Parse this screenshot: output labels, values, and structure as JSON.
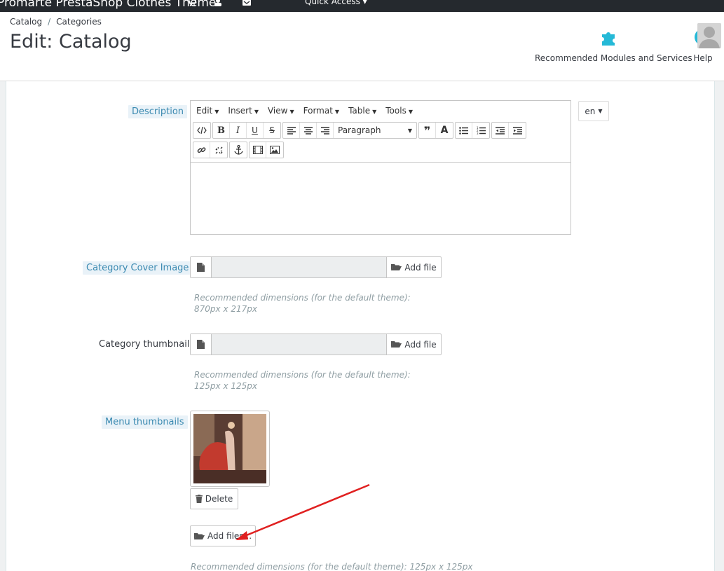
{
  "topbar": {
    "shop_name": "Promarte PrestaShop Clothes Theme",
    "quick_access": "Quick Access"
  },
  "breadcrumb": {
    "items": [
      "Catalog",
      "Categories"
    ]
  },
  "page_title": "Edit: Catalog",
  "toolbar": {
    "modules_label": "Recommended Modules and Services",
    "help_label": "Help"
  },
  "form": {
    "description": {
      "label": "Description",
      "menu": [
        "Edit",
        "Insert",
        "View",
        "Format",
        "Table",
        "Tools"
      ],
      "format_select": "Paragraph",
      "language": "en"
    },
    "cover_image": {
      "label": "Category Cover Image",
      "add_file": "Add file",
      "help": "Recommended dimensions (for the default theme): 870px x 217px"
    },
    "thumbnail": {
      "label": "Category thumbnail",
      "add_file": "Add file",
      "help": "Recommended dimensions (for the default theme): 125px x 125px"
    },
    "menu_thumbnails": {
      "label": "Menu thumbnails",
      "delete": "Delete",
      "add_files": "Add files...",
      "help": "Recommended dimensions (for the default theme): 125px x 125px"
    }
  },
  "colors": {
    "topbar": "#25292e",
    "accent": "#25b9d7",
    "label_tip_bg": "#e9f2f8",
    "label_tip_text": "#3b8ab1",
    "arrow": "#e02020"
  }
}
